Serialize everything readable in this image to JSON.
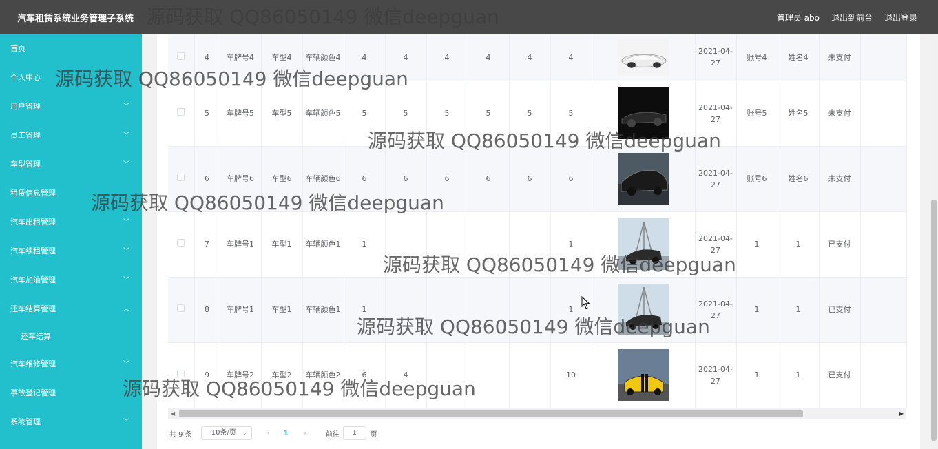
{
  "header": {
    "title": "汽车租赁系统业务管理子系统",
    "user": "管理员 abo",
    "to_front": "退出到前台",
    "logout": "退出登录"
  },
  "sidebar": {
    "items": [
      {
        "label": "首页",
        "arrow": ""
      },
      {
        "label": "个人中心",
        "arrow": ""
      },
      {
        "label": "用户管理",
        "arrow": "down"
      },
      {
        "label": "员工管理",
        "arrow": "down"
      },
      {
        "label": "车型管理",
        "arrow": "down"
      },
      {
        "label": "租赁信息管理",
        "arrow": ""
      },
      {
        "label": "汽车出租管理",
        "arrow": "down"
      },
      {
        "label": "汽车续租管理",
        "arrow": "down"
      },
      {
        "label": "汽车加油管理",
        "arrow": "down"
      },
      {
        "label": "还车结算管理",
        "arrow": "up"
      },
      {
        "label": "还车结算",
        "arrow": "",
        "sub": true
      },
      {
        "label": "汽车维修管理",
        "arrow": "down"
      },
      {
        "label": "事故登记管理",
        "arrow": ""
      },
      {
        "label": "系统管理",
        "arrow": "down"
      }
    ]
  },
  "table": {
    "rows": [
      {
        "idx": "4",
        "plate": "车牌号4",
        "model": "车型4",
        "color": "车辆颜色4",
        "c1": "4",
        "c2": "4",
        "c3": "4",
        "c4": "4",
        "c5": "4",
        "c6": "4",
        "date": "2021-04-27",
        "account": "账号4",
        "name": "姓名4",
        "status": "未支付",
        "image": "white-convertible"
      },
      {
        "idx": "5",
        "plate": "车牌号5",
        "model": "车型5",
        "color": "车辆颜色5",
        "c1": "5",
        "c2": "5",
        "c3": "5",
        "c4": "5",
        "c5": "5",
        "c6": "5",
        "date": "2021-04-27",
        "account": "账号5",
        "name": "姓名5",
        "status": "未支付",
        "image": "black-roadster"
      },
      {
        "idx": "6",
        "plate": "车牌号6",
        "model": "车型6",
        "color": "车辆颜色6",
        "c1": "6",
        "c2": "6",
        "c3": "6",
        "c4": "6",
        "c5": "6",
        "c6": "6",
        "date": "2021-04-27",
        "account": "账号6",
        "name": "姓名6",
        "status": "未支付",
        "image": "black-coupe"
      },
      {
        "idx": "7",
        "plate": "车牌号1",
        "model": "车型1",
        "color": "车辆颜色1",
        "c1": "1",
        "c2": "",
        "c3": "",
        "c4": "",
        "c5": "",
        "c6": "1",
        "date": "2021-04-27",
        "account": "1",
        "name": "1",
        "status": "已支付",
        "image": "bridge-car"
      },
      {
        "idx": "8",
        "plate": "车牌号1",
        "model": "车型1",
        "color": "车辆颜色1",
        "c1": "1",
        "c2": "",
        "c3": "",
        "c4": "",
        "c5": "",
        "c6": "1",
        "date": "2021-04-27",
        "account": "1",
        "name": "1",
        "status": "已支付",
        "image": "bridge-car"
      },
      {
        "idx": "9",
        "plate": "车牌号2",
        "model": "车型2",
        "color": "车辆颜色2",
        "c1": "6",
        "c2": "4",
        "c3": "",
        "c4": "",
        "c5": "",
        "c6": "10",
        "date": "2021-04-27",
        "account": "1",
        "name": "1",
        "status": "已支付",
        "image": "yellow-camaro"
      }
    ]
  },
  "pagination": {
    "total": "共 9 条",
    "page_size": "10条/页",
    "current": "1",
    "goto_label": "前往",
    "goto_value": "1",
    "unit": "页"
  },
  "watermark": "源码获取 QQ86050149 微信deepguan",
  "colors": {
    "sidebar": "#22c0cc",
    "topbar": "#484848",
    "active_page": "#22c0cc"
  }
}
